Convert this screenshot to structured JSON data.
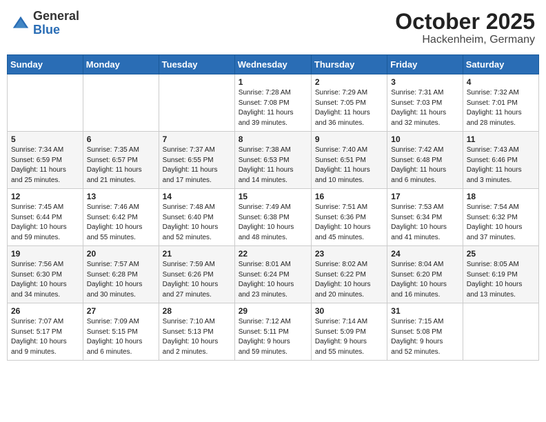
{
  "header": {
    "logo_general": "General",
    "logo_blue": "Blue",
    "month": "October 2025",
    "location": "Hackenheim, Germany"
  },
  "weekdays": [
    "Sunday",
    "Monday",
    "Tuesday",
    "Wednesday",
    "Thursday",
    "Friday",
    "Saturday"
  ],
  "weeks": [
    [
      {
        "day": "",
        "info": ""
      },
      {
        "day": "",
        "info": ""
      },
      {
        "day": "",
        "info": ""
      },
      {
        "day": "1",
        "info": "Sunrise: 7:28 AM\nSunset: 7:08 PM\nDaylight: 11 hours\nand 39 minutes."
      },
      {
        "day": "2",
        "info": "Sunrise: 7:29 AM\nSunset: 7:05 PM\nDaylight: 11 hours\nand 36 minutes."
      },
      {
        "day": "3",
        "info": "Sunrise: 7:31 AM\nSunset: 7:03 PM\nDaylight: 11 hours\nand 32 minutes."
      },
      {
        "day": "4",
        "info": "Sunrise: 7:32 AM\nSunset: 7:01 PM\nDaylight: 11 hours\nand 28 minutes."
      }
    ],
    [
      {
        "day": "5",
        "info": "Sunrise: 7:34 AM\nSunset: 6:59 PM\nDaylight: 11 hours\nand 25 minutes."
      },
      {
        "day": "6",
        "info": "Sunrise: 7:35 AM\nSunset: 6:57 PM\nDaylight: 11 hours\nand 21 minutes."
      },
      {
        "day": "7",
        "info": "Sunrise: 7:37 AM\nSunset: 6:55 PM\nDaylight: 11 hours\nand 17 minutes."
      },
      {
        "day": "8",
        "info": "Sunrise: 7:38 AM\nSunset: 6:53 PM\nDaylight: 11 hours\nand 14 minutes."
      },
      {
        "day": "9",
        "info": "Sunrise: 7:40 AM\nSunset: 6:51 PM\nDaylight: 11 hours\nand 10 minutes."
      },
      {
        "day": "10",
        "info": "Sunrise: 7:42 AM\nSunset: 6:48 PM\nDaylight: 11 hours\nand 6 minutes."
      },
      {
        "day": "11",
        "info": "Sunrise: 7:43 AM\nSunset: 6:46 PM\nDaylight: 11 hours\nand 3 minutes."
      }
    ],
    [
      {
        "day": "12",
        "info": "Sunrise: 7:45 AM\nSunset: 6:44 PM\nDaylight: 10 hours\nand 59 minutes."
      },
      {
        "day": "13",
        "info": "Sunrise: 7:46 AM\nSunset: 6:42 PM\nDaylight: 10 hours\nand 55 minutes."
      },
      {
        "day": "14",
        "info": "Sunrise: 7:48 AM\nSunset: 6:40 PM\nDaylight: 10 hours\nand 52 minutes."
      },
      {
        "day": "15",
        "info": "Sunrise: 7:49 AM\nSunset: 6:38 PM\nDaylight: 10 hours\nand 48 minutes."
      },
      {
        "day": "16",
        "info": "Sunrise: 7:51 AM\nSunset: 6:36 PM\nDaylight: 10 hours\nand 45 minutes."
      },
      {
        "day": "17",
        "info": "Sunrise: 7:53 AM\nSunset: 6:34 PM\nDaylight: 10 hours\nand 41 minutes."
      },
      {
        "day": "18",
        "info": "Sunrise: 7:54 AM\nSunset: 6:32 PM\nDaylight: 10 hours\nand 37 minutes."
      }
    ],
    [
      {
        "day": "19",
        "info": "Sunrise: 7:56 AM\nSunset: 6:30 PM\nDaylight: 10 hours\nand 34 minutes."
      },
      {
        "day": "20",
        "info": "Sunrise: 7:57 AM\nSunset: 6:28 PM\nDaylight: 10 hours\nand 30 minutes."
      },
      {
        "day": "21",
        "info": "Sunrise: 7:59 AM\nSunset: 6:26 PM\nDaylight: 10 hours\nand 27 minutes."
      },
      {
        "day": "22",
        "info": "Sunrise: 8:01 AM\nSunset: 6:24 PM\nDaylight: 10 hours\nand 23 minutes."
      },
      {
        "day": "23",
        "info": "Sunrise: 8:02 AM\nSunset: 6:22 PM\nDaylight: 10 hours\nand 20 minutes."
      },
      {
        "day": "24",
        "info": "Sunrise: 8:04 AM\nSunset: 6:20 PM\nDaylight: 10 hours\nand 16 minutes."
      },
      {
        "day": "25",
        "info": "Sunrise: 8:05 AM\nSunset: 6:19 PM\nDaylight: 10 hours\nand 13 minutes."
      }
    ],
    [
      {
        "day": "26",
        "info": "Sunrise: 7:07 AM\nSunset: 5:17 PM\nDaylight: 10 hours\nand 9 minutes."
      },
      {
        "day": "27",
        "info": "Sunrise: 7:09 AM\nSunset: 5:15 PM\nDaylight: 10 hours\nand 6 minutes."
      },
      {
        "day": "28",
        "info": "Sunrise: 7:10 AM\nSunset: 5:13 PM\nDaylight: 10 hours\nand 2 minutes."
      },
      {
        "day": "29",
        "info": "Sunrise: 7:12 AM\nSunset: 5:11 PM\nDaylight: 9 hours\nand 59 minutes."
      },
      {
        "day": "30",
        "info": "Sunrise: 7:14 AM\nSunset: 5:09 PM\nDaylight: 9 hours\nand 55 minutes."
      },
      {
        "day": "31",
        "info": "Sunrise: 7:15 AM\nSunset: 5:08 PM\nDaylight: 9 hours\nand 52 minutes."
      },
      {
        "day": "",
        "info": ""
      }
    ]
  ]
}
